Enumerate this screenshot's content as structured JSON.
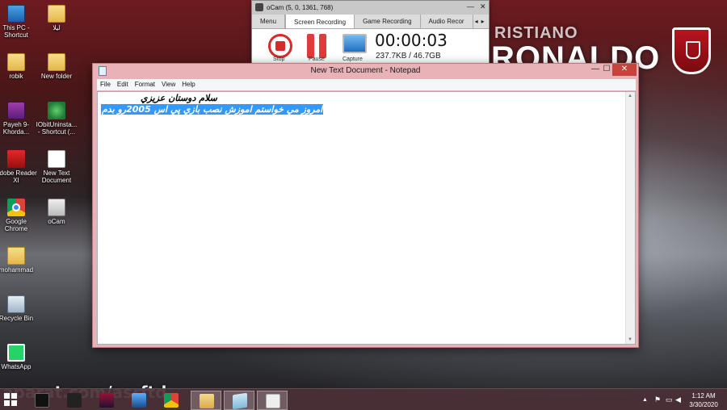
{
  "desktop": {
    "icons": [
      {
        "label": "This PC - Shortcut"
      },
      {
        "label": "ليلا"
      },
      {
        "label": "robik"
      },
      {
        "label": "New folder"
      },
      {
        "label": "Payeh 9-Khorda..."
      },
      {
        "label": "IObitUninsta... - Shortcut (..."
      },
      {
        "label": "Adobe Reader XI"
      },
      {
        "label": "New Text Document"
      },
      {
        "label": "Google Chrome"
      },
      {
        "label": "oCam"
      },
      {
        "label": "mohammad"
      },
      {
        "label": "Recycle Bin"
      },
      {
        "label": "WhatsApp"
      }
    ],
    "wallpaper_text_1": "RISTIANO",
    "wallpaper_text_2": "RONALDO",
    "watermark": "aparat.com/asrftd"
  },
  "ocam": {
    "title": "oCam (5, 0, 1361, 768)",
    "tabs": [
      "Menu",
      "Screen Recording",
      "Game Recording",
      "Audio Recor"
    ],
    "active_tab": "Screen Recording",
    "tab_scroll_left": "◂",
    "tab_scroll_right": "▸",
    "minimize": "—",
    "close": "✕",
    "stop_label": "Stop",
    "pause_label": "Pause",
    "capture_label": "Capture",
    "timer": "00:00:03",
    "size": "237.7KB / 46.7GB"
  },
  "notepad": {
    "title": "New Text Document - Notepad",
    "menu": [
      "File",
      "Edit",
      "Format",
      "View",
      "Help"
    ],
    "minimize": "—",
    "maximize": "☐",
    "close": "✕",
    "lines": [
      "سلام دوستان عزیزي",
      "امروز مي خواستم اموزش نصب بازي پي اس 2005رو بدم"
    ],
    "selected_line_index": 1
  },
  "taskbar": {
    "tray_arrow": "▲",
    "time": "1:12 AM",
    "date": "3/30/2020"
  },
  "colors": {
    "notepad_frame": "#e8b2b6",
    "selection": "#3399ff",
    "taskbar": "#4b3038",
    "ocam_stop": "#d62b2b"
  }
}
